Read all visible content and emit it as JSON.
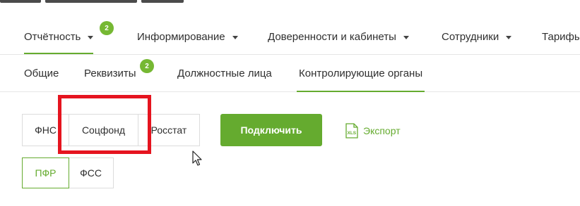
{
  "main_nav": {
    "items": [
      {
        "label": "Отчётность",
        "badge": "2"
      },
      {
        "label": "Информирование"
      },
      {
        "label": "Доверенности и кабинеты"
      },
      {
        "label": "Сотрудники"
      },
      {
        "label": "Тарифы"
      }
    ]
  },
  "sub_nav": {
    "items": [
      {
        "label": "Общие"
      },
      {
        "label": "Реквизиты",
        "badge": "2"
      },
      {
        "label": "Должностные лица"
      },
      {
        "label": "Контролирующие органы"
      }
    ]
  },
  "agencies": {
    "row1": [
      "ФНС",
      "Соцфонд",
      "Росстат"
    ],
    "row2": [
      "ПФР",
      "ФСС"
    ]
  },
  "actions": {
    "connect_label": "Подключить",
    "export_label": "Экспорт"
  },
  "colors": {
    "accent": "#65ab2f",
    "highlight": "#e5141f"
  }
}
